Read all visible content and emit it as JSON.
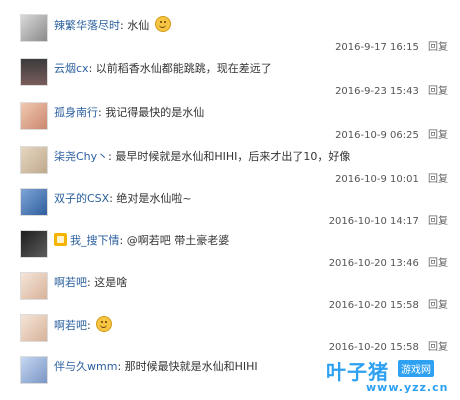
{
  "comments": [
    {
      "user": "辣繁华落尽时",
      "text": "水仙",
      "datetime": "2016-9-17 16:15",
      "reply": "回复",
      "emoji": "smiley-icon"
    },
    {
      "user": "云烟cx",
      "text": "以前稻香水仙都能跳跳，现在差远了",
      "datetime": "2016-9-23 15:43",
      "reply": "回复"
    },
    {
      "user": "孤身南行",
      "text": "我记得最快的是水仙",
      "datetime": "2016-10-9 06:25",
      "reply": "回复"
    },
    {
      "user": "柒尧Chy丶",
      "text": "最早时候就是水仙和HIHI，后来才出了10，好像",
      "datetime": "2016-10-9 10:01",
      "reply": "回复"
    },
    {
      "user": "双子的CSX",
      "text": "绝对是水仙啦~",
      "datetime": "2016-10-10 14:17",
      "reply": "回复"
    },
    {
      "user": "我_搜下情",
      "text": "@啊若吧 带土豪老婆",
      "datetime": "2016-10-20 13:46",
      "reply": "回复",
      "badge": "vip-icon"
    },
    {
      "user": "啊若吧",
      "text": "这是啥",
      "datetime": "2016-10-20 15:58",
      "reply": "回复"
    },
    {
      "user": "啊若吧",
      "text": "",
      "datetime": "2016-10-20 15:58",
      "reply": "回复",
      "emoji": "smiley-icon"
    },
    {
      "user": "伴与久wmm",
      "text": "那时候最快就是水仙和HIHI",
      "datetime": "",
      "reply": ""
    }
  ],
  "colors": {
    "username": "#2a5f9e",
    "watermark": "#2ea1f2"
  },
  "watermark": {
    "brand": "叶子猪",
    "tag": "游戏网",
    "url": "www.yzz.cn"
  }
}
